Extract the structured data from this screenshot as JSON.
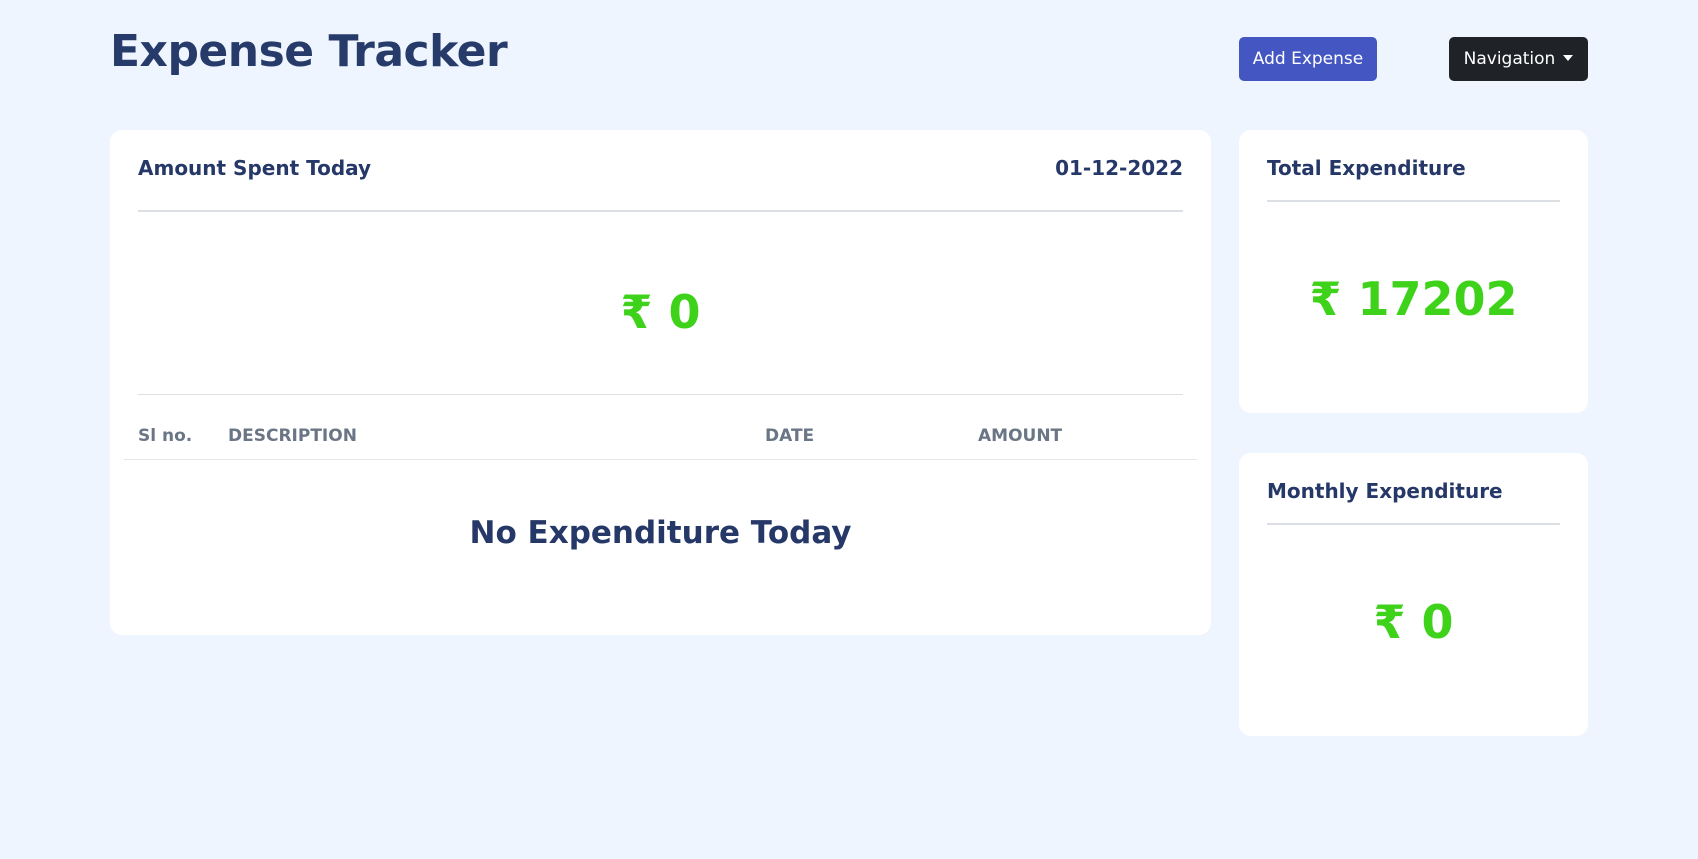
{
  "header": {
    "title": "Expense Tracker",
    "add_button": "Add Expense",
    "nav_button": "Navigation"
  },
  "today_card": {
    "heading": "Amount Spent Today",
    "date": "01-12-2022",
    "amount": "₹ 0",
    "table": {
      "columns": [
        "Sl no.",
        "DESCRIPTION",
        "DATE",
        "AMOUNT"
      ],
      "rows": []
    },
    "empty_message": "No Expenditure Today"
  },
  "total_card": {
    "heading": "Total Expenditure",
    "amount": "₹ 17202"
  },
  "monthly_card": {
    "heading": "Monthly Expenditure",
    "amount": "₹ 0"
  },
  "colors": {
    "background": "#eff5fe",
    "primary_button": "#4456c2",
    "dark_button": "#1f2327",
    "amount_green": "#3ed21b",
    "heading_navy": "#263868"
  }
}
